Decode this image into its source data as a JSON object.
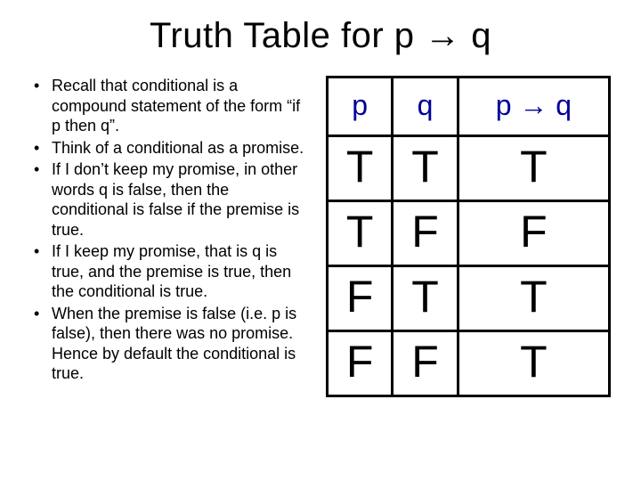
{
  "title": "Truth Table for p → q",
  "bullets": [
    "Recall that conditional is a compound statement of the form “if p then q”.",
    "Think of a conditional as a promise.",
    "If I don’t keep my promise, in other words q is false, then the conditional is false if the premise is true.",
    "If I keep my promise, that is q is true, and the premise is true, then the conditional is true.",
    "When the premise is false (i.e. p is false), then there was no promise. Hence by default the conditional is true."
  ],
  "table": {
    "headers": [
      "p",
      "q",
      "p → q"
    ],
    "rows": [
      [
        "T",
        "T",
        "T"
      ],
      [
        "T",
        "F",
        "F"
      ],
      [
        "F",
        "T",
        "T"
      ],
      [
        "F",
        "F",
        "T"
      ]
    ]
  },
  "chart_data": {
    "type": "table",
    "title": "Truth Table for p → q",
    "columns": [
      "p",
      "q",
      "p → q"
    ],
    "rows": [
      {
        "p": "T",
        "q": "T",
        "p→q": "T"
      },
      {
        "p": "T",
        "q": "F",
        "p→q": "F"
      },
      {
        "p": "F",
        "q": "T",
        "p→q": "T"
      },
      {
        "p": "F",
        "q": "F",
        "p→q": "T"
      }
    ]
  }
}
